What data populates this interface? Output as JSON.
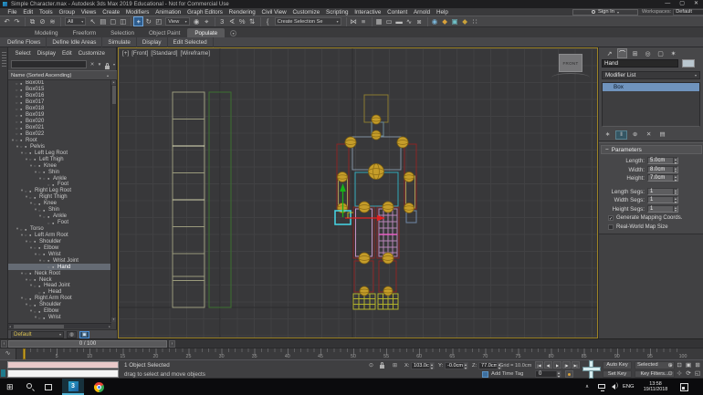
{
  "window": {
    "title": "Simple Character.max - Autodesk 3ds Max 2019 Educational - Not for Commercial Use",
    "controls": {
      "minimize": "—",
      "maximize": "▢",
      "close": "✕"
    }
  },
  "account": {
    "sign_in": "Sign In",
    "workspaces_label": "Workspaces:",
    "workspaces_value": "Default"
  },
  "menus": [
    "File",
    "Edit",
    "Tools",
    "Group",
    "Views",
    "Create",
    "Modifiers",
    "Animation",
    "Graph Editors",
    "Rendering",
    "Civil View",
    "Customize",
    "Scripting",
    "Interactive",
    "Content",
    "Arnold",
    "Help"
  ],
  "toolbar": {
    "items": [
      {
        "t": "i",
        "name": "undo-icon",
        "g": "↶"
      },
      {
        "t": "i",
        "name": "redo-icon",
        "g": "↷"
      },
      {
        "t": "s"
      },
      {
        "t": "i",
        "name": "select-and-link-icon",
        "g": "⧉"
      },
      {
        "t": "i",
        "name": "unlink-selection-icon",
        "g": "⊘"
      },
      {
        "t": "i",
        "name": "bind-to-space-warp-icon",
        "g": "≋"
      },
      {
        "t": "s"
      },
      {
        "t": "d",
        "name": "selection-filter-dropdown",
        "label": "All"
      },
      {
        "t": "i",
        "name": "select-object-icon",
        "g": "↖"
      },
      {
        "t": "i",
        "name": "select-by-name-icon",
        "g": "▤"
      },
      {
        "t": "i",
        "name": "rectangular-selection-region-icon",
        "g": "▢"
      },
      {
        "t": "i",
        "name": "window-crossing-icon",
        "g": "◫"
      },
      {
        "t": "s"
      },
      {
        "t": "i",
        "name": "select-and-move-icon",
        "g": "+",
        "active": 1
      },
      {
        "t": "i",
        "name": "select-and-rotate-icon",
        "g": "↻"
      },
      {
        "t": "i",
        "name": "select-and-scale-icon",
        "g": "◰"
      },
      {
        "t": "d",
        "name": "reference-coordinate-system-dropdown",
        "label": "View"
      },
      {
        "t": "i",
        "name": "use-pivot-center-icon",
        "g": "◉"
      },
      {
        "t": "i",
        "name": "select-and-manipulate-icon",
        "g": "⌖"
      },
      {
        "t": "s"
      },
      {
        "t": "i",
        "name": "snaps-toggle-icon",
        "g": "3"
      },
      {
        "t": "i",
        "name": "angle-snap-icon",
        "g": "∢"
      },
      {
        "t": "i",
        "name": "percent-snap-icon",
        "g": "%"
      },
      {
        "t": "i",
        "name": "spinner-snap-icon",
        "g": "⇅"
      },
      {
        "t": "s"
      },
      {
        "t": "i",
        "name": "edit-named-selection-sets-icon",
        "g": "{"
      },
      {
        "t": "d",
        "name": "named-selection-sets-dropdown",
        "label": "Create Selection Se"
      },
      {
        "t": "s"
      },
      {
        "t": "i",
        "name": "mirror-icon",
        "g": "⋈"
      },
      {
        "t": "i",
        "name": "align-icon",
        "g": "≡"
      },
      {
        "t": "s"
      },
      {
        "t": "i",
        "name": "toggle-scene-explorer-icon",
        "g": "▦"
      },
      {
        "t": "i",
        "name": "toggle-layer-explorer-icon",
        "g": "▭"
      },
      {
        "t": "i",
        "name": "toggle-ribbon-icon",
        "g": "▬"
      },
      {
        "t": "i",
        "name": "curve-editor-icon",
        "g": "∿"
      },
      {
        "t": "i",
        "name": "schematic-view-icon",
        "g": "⧈"
      },
      {
        "t": "s"
      },
      {
        "t": "i",
        "name": "material-editor-icon",
        "g": "◉",
        "c": "#7ab6d9"
      },
      {
        "t": "i",
        "name": "render-setup-icon",
        "g": "◆",
        "c": "#d9a13a"
      },
      {
        "t": "i",
        "name": "rendered-frame-window-icon",
        "g": "▣",
        "c": "#6fc2c9"
      },
      {
        "t": "i",
        "name": "render-production-icon",
        "g": "◆",
        "c": "#c9a13a"
      },
      {
        "t": "i",
        "name": "render-in-cloud-icon",
        "g": "∷"
      }
    ]
  },
  "ribbon": {
    "tabs": [
      {
        "label": "Modeling"
      },
      {
        "label": "Freeform"
      },
      {
        "label": "Selection"
      },
      {
        "label": "Object Paint"
      },
      {
        "label": "Populate",
        "active": 1
      }
    ],
    "buttons": [
      "Define Flows",
      "Define Idle Areas",
      "Simulate",
      "Display",
      "Edit Selected"
    ]
  },
  "explorer": {
    "menu": [
      "Select",
      "Display",
      "Edit",
      "Customize"
    ],
    "search_placeholder": "",
    "header": "Name (Sorted Ascending)",
    "bottom_value": "Default",
    "tree": [
      {
        "l": "Box001",
        "i": 0,
        "a": 0,
        "s": 0
      },
      {
        "l": "Box015",
        "i": 0,
        "a": 0,
        "s": 0
      },
      {
        "l": "Box016",
        "i": 0,
        "a": 0,
        "s": 0
      },
      {
        "l": "Box017",
        "i": 0,
        "a": 0,
        "s": 0
      },
      {
        "l": "Box018",
        "i": 0,
        "a": 0,
        "s": 0
      },
      {
        "l": "Box019",
        "i": 0,
        "a": 0,
        "s": 0
      },
      {
        "l": "Box020",
        "i": 0,
        "a": 0,
        "s": 0
      },
      {
        "l": "Box021",
        "i": 0,
        "a": 0,
        "s": 0
      },
      {
        "l": "Box022",
        "i": 0,
        "a": 0,
        "s": 0
      },
      {
        "l": "Root",
        "i": 0,
        "a": 1,
        "s": 0
      },
      {
        "l": "Pelvis",
        "i": 1,
        "a": 1,
        "s": 0
      },
      {
        "l": "Left Leg Root",
        "i": 2,
        "a": 1,
        "s": 0
      },
      {
        "l": "Left Thigh",
        "i": 3,
        "a": 1,
        "s": 0
      },
      {
        "l": "Knee",
        "i": 4,
        "a": 1,
        "s": 0
      },
      {
        "l": "Shin",
        "i": 5,
        "a": 1,
        "s": 0
      },
      {
        "l": "Ankle",
        "i": 6,
        "a": 1,
        "s": 0
      },
      {
        "l": "Foot",
        "i": 7,
        "a": 0,
        "s": 0
      },
      {
        "l": "Right Leg Root",
        "i": 2,
        "a": 1,
        "s": 0
      },
      {
        "l": "Right Thigh",
        "i": 3,
        "a": 1,
        "s": 0
      },
      {
        "l": "Knee",
        "i": 4,
        "a": 1,
        "s": 0
      },
      {
        "l": "Shin",
        "i": 5,
        "a": 1,
        "s": 0
      },
      {
        "l": "Ankle",
        "i": 6,
        "a": 1,
        "s": 0
      },
      {
        "l": "Foot",
        "i": 7,
        "a": 0,
        "s": 0
      },
      {
        "l": "Torso",
        "i": 1,
        "a": 1,
        "s": 0
      },
      {
        "l": "Left Arm Root",
        "i": 2,
        "a": 1,
        "s": 0
      },
      {
        "l": "Shoulder",
        "i": 3,
        "a": 1,
        "s": 0
      },
      {
        "l": "Elbow",
        "i": 4,
        "a": 1,
        "s": 0
      },
      {
        "l": "Wrist",
        "i": 5,
        "a": 1,
        "s": 0
      },
      {
        "l": "Wrist Joint",
        "i": 6,
        "a": 1,
        "s": 0
      },
      {
        "l": "Hand",
        "i": 7,
        "a": 0,
        "s": 1
      },
      {
        "l": "Neck Root",
        "i": 2,
        "a": 1,
        "s": 0
      },
      {
        "l": "Neck",
        "i": 3,
        "a": 1,
        "s": 0
      },
      {
        "l": "Head Joint",
        "i": 4,
        "a": 1,
        "s": 0
      },
      {
        "l": "Head",
        "i": 5,
        "a": 0,
        "s": 0
      },
      {
        "l": "Right Arm Root",
        "i": 2,
        "a": 1,
        "s": 0
      },
      {
        "l": "Shoulder",
        "i": 3,
        "a": 1,
        "s": 0
      },
      {
        "l": "Elbow",
        "i": 4,
        "a": 1,
        "s": 0
      },
      {
        "l": "Wrist",
        "i": 5,
        "a": 1,
        "s": 0
      }
    ]
  },
  "viewport": {
    "label_segments": [
      {
        "name": "viewport-general-menu",
        "text": "[+]"
      },
      {
        "name": "viewport-pov-menu",
        "text": "[Front]"
      },
      {
        "name": "viewport-renderer-menu",
        "text": "[Standard]"
      },
      {
        "name": "viewport-shading-menu",
        "text": "[Wireframe]"
      }
    ],
    "viewcube": "FRONT"
  },
  "command_panel": {
    "tabs": [
      {
        "name": "create-tab-icon",
        "g": "↗"
      },
      {
        "name": "modify-tab-icon",
        "g": "⌒",
        "active": 1
      },
      {
        "name": "hierarchy-tab-icon",
        "g": "⊞"
      },
      {
        "name": "motion-tab-icon",
        "g": "◎"
      },
      {
        "name": "display-tab-icon",
        "g": "▢"
      },
      {
        "name": "utilities-tab-icon",
        "g": "✶"
      }
    ],
    "object_name": "Hand",
    "modifier_list_label": "Modifier List",
    "stack": [
      {
        "label": "Box",
        "selected": 1
      }
    ],
    "stack_tools": [
      {
        "name": "pin-stack-icon",
        "g": "∗"
      },
      {
        "name": "show-end-result-icon",
        "g": "‖",
        "hl": 1
      },
      {
        "name": "make-unique-icon",
        "g": "⊕"
      },
      {
        "name": "remove-modifier-icon",
        "g": "✕"
      },
      {
        "name": "configure-modifier-sets-icon",
        "g": "▤"
      }
    ],
    "rollout_title": "Parameters",
    "rollout_minus": "−",
    "params": [
      {
        "label": "Length:",
        "value": "5.0cm"
      },
      {
        "label": "Width:",
        "value": "8.0cm"
      },
      {
        "label": "Height:",
        "value": "7.0cm"
      },
      {
        "label": "Length Segs:",
        "value": "1"
      },
      {
        "label": "Width Segs:",
        "value": "1"
      },
      {
        "label": "Height Segs:",
        "value": "1"
      }
    ],
    "checks": [
      {
        "label": "Generate Mapping Coords.",
        "checked": 1
      },
      {
        "label": "Real-World Map Size",
        "checked": 0
      }
    ]
  },
  "timeline": {
    "slider_value": "0 / 100",
    "prev_label": "‹",
    "next_label": "›",
    "tick_labels": [
      5,
      10,
      15,
      20,
      25,
      30,
      35,
      40,
      45,
      50,
      55,
      60,
      65,
      70,
      75,
      80,
      85,
      90,
      95,
      100
    ]
  },
  "status": {
    "object_count": "1 Object Selected",
    "prompt": "drag to select and move objects",
    "x_label": "X:",
    "x_value": "103.0cm",
    "y_label": "Y:",
    "y_value": "-0.0cm",
    "z_label": "Z:",
    "z_value": "77.0cm",
    "grid_label": "Grid = 10.0cm",
    "add_time_tag": "Add Time Tag",
    "auto_key": "Auto Key",
    "set_key": "Set Key",
    "key_mode_value": "Selected",
    "key_filters": "Key Filters...",
    "frame_value": "0",
    "playback": [
      {
        "name": "go-to-start-button",
        "g": "|◀"
      },
      {
        "name": "previous-frame-button",
        "g": "◀|"
      },
      {
        "name": "play-button",
        "g": "▶"
      },
      {
        "name": "next-frame-button",
        "g": "|▶"
      },
      {
        "name": "go-to-end-button",
        "g": "▶|"
      }
    ],
    "nav": [
      {
        "name": "zoom-icon",
        "g": "⊕"
      },
      {
        "name": "zoom-all-icon",
        "g": "⊡"
      },
      {
        "name": "zoom-extents-icon",
        "g": "▣"
      },
      {
        "name": "zoom-extents-all-icon",
        "g": "⊞"
      },
      {
        "name": "field-of-view-icon",
        "g": "⊙"
      },
      {
        "name": "pan-icon",
        "g": "⊹"
      },
      {
        "name": "orbit-icon",
        "g": "⟳"
      },
      {
        "name": "maximize-viewport-toggle-icon",
        "g": "◱"
      }
    ]
  },
  "taskbar": {
    "lang": "ENG",
    "time": "13:58",
    "date": "19/11/2018"
  },
  "icons": {
    "clear_search": "✕",
    "filter": "▼",
    "chevron_down": "▾",
    "scroll_up": "▴",
    "scroll_down": "▾",
    "scroll_left": "◂",
    "scroll_right": "▸",
    "sort": "▴",
    "curve_editor": "∿",
    "header_sort": "a▾",
    "isolate": "⊙",
    "abs_offset": "⊞",
    "explorer_display": "◍",
    "explorer_layout": "▣"
  },
  "colors": {
    "accent_blue": "#4a90d9",
    "viewport_border": "#9c8326",
    "selection_highlight": "#6f93bd",
    "joint_yellow": "#c59d2a",
    "gizmo_green": "#18b418",
    "gizmo_red": "#e02020",
    "hand_selected_cyan": "#45d8e8",
    "autokey_off_gray": "#4c4c4e"
  }
}
